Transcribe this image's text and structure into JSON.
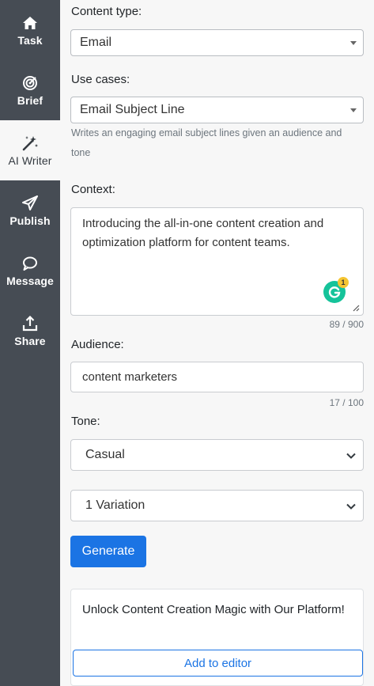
{
  "sidebar": {
    "items": [
      {
        "label": "Task",
        "icon": "home-icon"
      },
      {
        "label": "Brief",
        "icon": "target-icon"
      },
      {
        "label": "AI Writer",
        "icon": "magic-wand-icon",
        "active": true
      },
      {
        "label": "Publish",
        "icon": "paper-plane-icon"
      },
      {
        "label": "Message",
        "icon": "chat-bubble-icon"
      },
      {
        "label": "Share",
        "icon": "share-upload-icon"
      }
    ]
  },
  "form": {
    "content_type": {
      "label": "Content type:",
      "value": "Email"
    },
    "use_cases": {
      "label": "Use cases:",
      "value": "Email Subject Line",
      "helper": "Writes an engaging email subject lines given an audience and tone"
    },
    "context": {
      "label": "Context:",
      "value": "Introducing the all-in-one content creation and optimization platform for content teams.",
      "counter": "89 / 900",
      "grammarly_count": "1"
    },
    "audience": {
      "label": "Audience:",
      "value": "content marketers",
      "counter": "17 / 100"
    },
    "tone": {
      "label": "Tone:",
      "value": "Casual"
    },
    "variations": {
      "value": "1 Variation"
    },
    "generate_label": "Generate"
  },
  "result": {
    "text": "Unlock Content Creation Magic with Our Platform!",
    "add_label": "Add to editor"
  },
  "colors": {
    "sidebar_bg": "#464c54",
    "primary": "#1b74e4",
    "grammarly": "#15c39a"
  }
}
